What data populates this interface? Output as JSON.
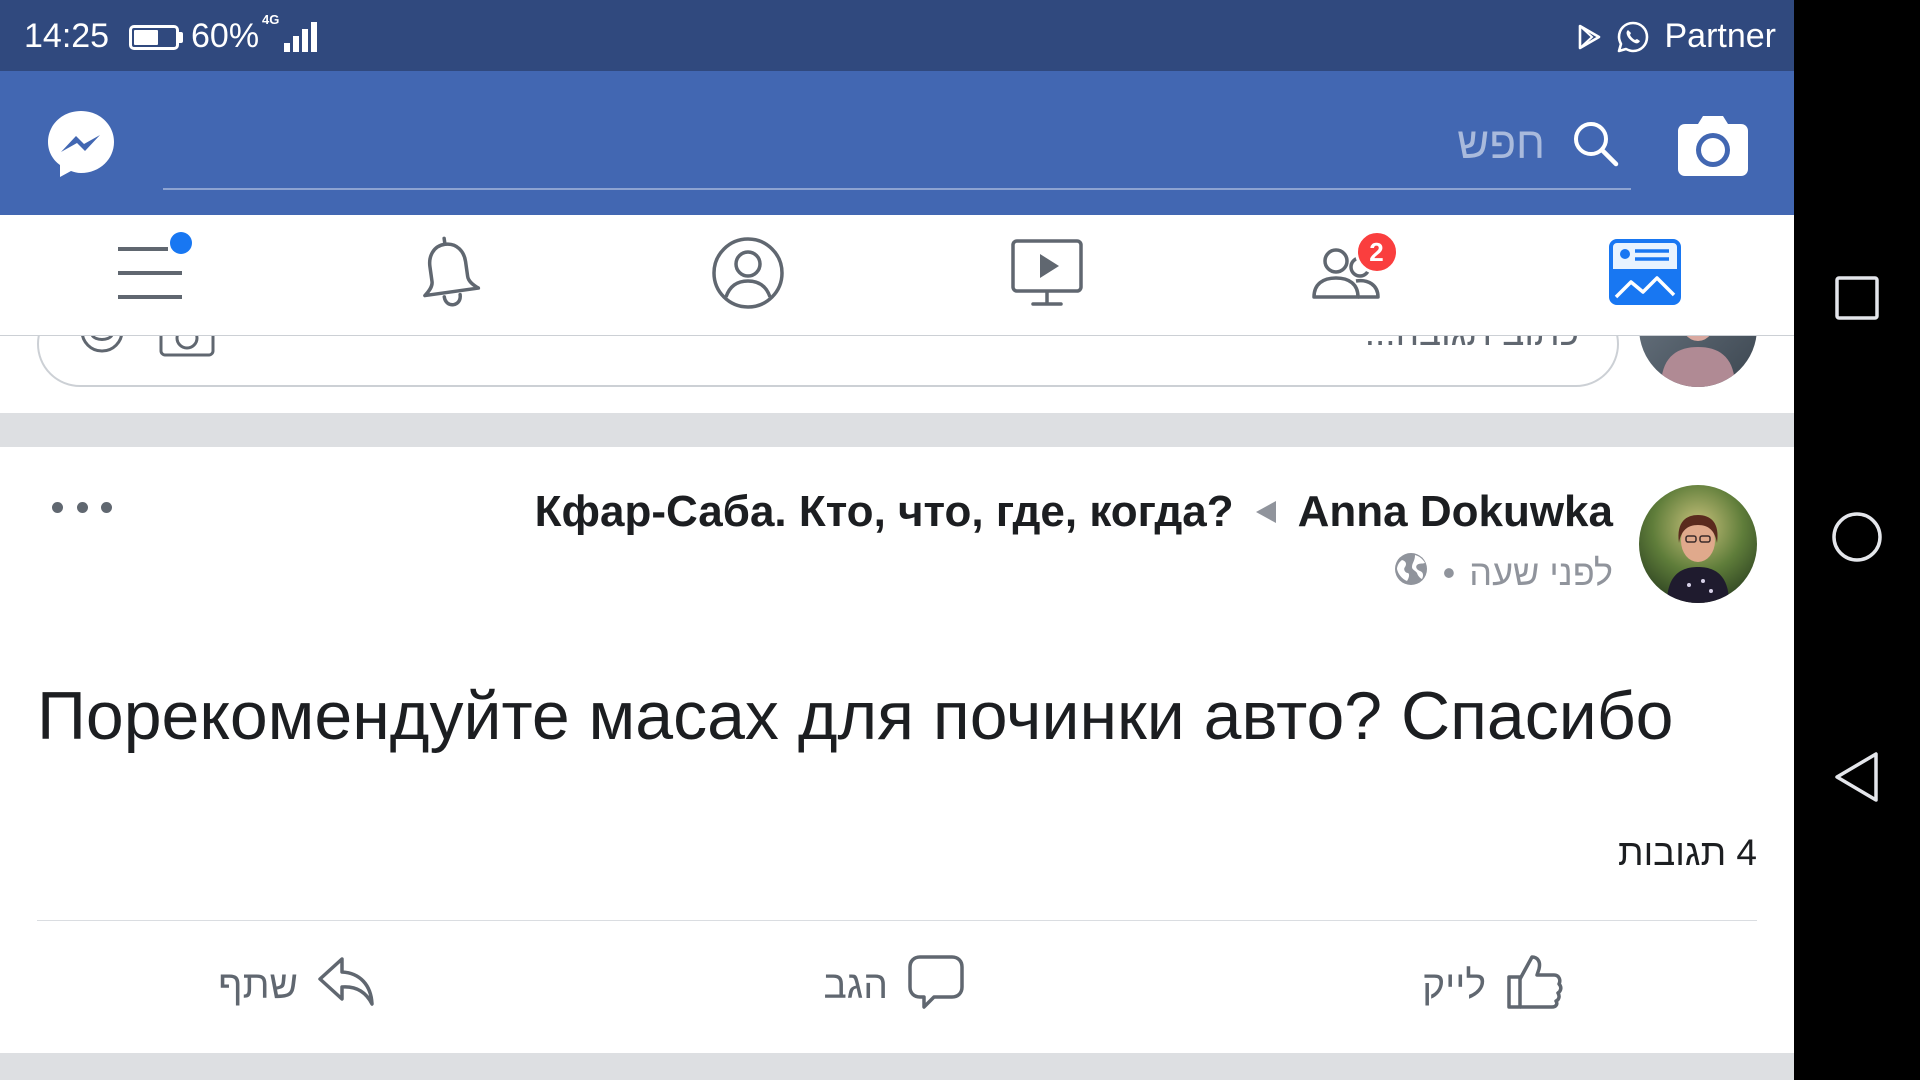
{
  "status_bar": {
    "time": "14:25",
    "battery_text": "60%",
    "battery_level": 0.6,
    "network": "4G",
    "carrier": "Partner",
    "icons": [
      "battery-icon",
      "signal-icon",
      "play-store-icon",
      "whatsapp-icon"
    ]
  },
  "header": {
    "search_placeholder": "חפש",
    "icons": [
      "messenger-icon",
      "search-icon",
      "camera-icon"
    ]
  },
  "tabs": [
    {
      "icon": "menu-icon",
      "notification_dot": true
    },
    {
      "icon": "bell-icon"
    },
    {
      "icon": "profile-icon"
    },
    {
      "icon": "video-icon"
    },
    {
      "icon": "friends-icon",
      "badge": "2"
    },
    {
      "icon": "news-feed-icon",
      "active": true
    }
  ],
  "comment_box": {
    "placeholder": "כתוב תגובה...",
    "icons": [
      "emoji-icon",
      "photo-camera-icon",
      "user-avatar"
    ]
  },
  "post": {
    "author": "Anna Dokuwka",
    "group": "Кфар-Саба. Кто, что, где, когда?",
    "time": "לפני שעה",
    "separator": "•",
    "icons": [
      "author-avatar",
      "arrow-icon",
      "globe-icon",
      "more-options-icon"
    ],
    "text": "Порекомендуйте масах для починки авто? Спасибо",
    "comments_count": "4 תגובות",
    "actions": {
      "like": "לייק",
      "comment": "הגב",
      "share": "שתף"
    },
    "action_icons": [
      "thumbs-up-icon",
      "comment-icon",
      "share-icon"
    ]
  },
  "system_nav": {
    "icons": [
      "recent-apps-icon",
      "home-icon",
      "back-icon"
    ]
  },
  "colors": {
    "status_bar": "#30497e",
    "header": "#4267b2",
    "active_tab": "#1877f2",
    "badge": "#fa3e3e",
    "divider": "#dadde1",
    "primary_text": "#1c1e21",
    "secondary_text": "#606770",
    "meta_text": "#90949c"
  }
}
